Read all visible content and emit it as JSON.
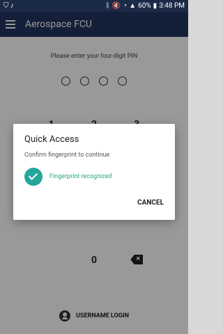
{
  "status": {
    "battery": "60%",
    "time": "3:48 PM"
  },
  "app": {
    "title": "Aerospace FCU"
  },
  "pin": {
    "prompt": "Please enter your four-digit PIN"
  },
  "keypad": {
    "row1": [
      "1",
      "2",
      "3"
    ],
    "zero": "0"
  },
  "login": {
    "username": "USERNAME LOGIN"
  },
  "dialog": {
    "title": "Quick Access",
    "subtitle": "Confirm fingerprint to continue",
    "status": "Fingerprint recognized",
    "cancel": "CANCEL"
  },
  "colors": {
    "appbar": "#223660",
    "statusbar": "#1b2a47",
    "accent": "#26a69a",
    "success_text": "#2aa77b"
  }
}
